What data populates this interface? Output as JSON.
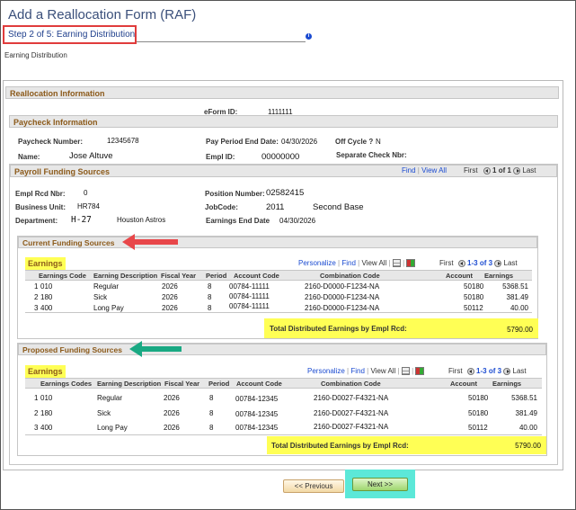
{
  "header": {
    "title": "Add a Reallocation Form (RAF)",
    "step": "Step 2 of 5: Earning Distribution",
    "info_icon": "i",
    "subtitle": "Earning Distribution"
  },
  "realloc": {
    "heading": "Reallocation Information",
    "eform_label": "eForm ID:",
    "eform_value": "1111111"
  },
  "paycheck": {
    "heading": "Paycheck Information",
    "check_number_label": "Paycheck Number:",
    "check_number_value": "12345678",
    "period_end_label": "Pay Period End Date:",
    "period_end_value": "04/30/2026",
    "off_cycle_label": "Off Cycle ?",
    "off_cycle_value": "N",
    "name_label": "Name:",
    "name_value": "Jose Altuve",
    "emplid_label": "Empl ID:",
    "emplid_value": "00000000",
    "separate_check_label": "Separate Check Nbr:"
  },
  "payroll": {
    "heading": "Payroll Funding Sources",
    "find": "Find",
    "view_all": "View All",
    "first": "First",
    "count": "1 of 1",
    "last": "Last",
    "rcd_label": "Empl Rcd Nbr:",
    "rcd_value": "0",
    "position_label": "Position Number:",
    "position_value": "02582415",
    "bu_label": "Business Unit:",
    "bu_value": "HR784",
    "jobcode_label": "JobCode:",
    "jobcode_value": "2011",
    "jobcode_desc": "Second Base",
    "dept_label": "Department:",
    "dept_value": "H-27",
    "dept_desc": "Houston Astros",
    "earn_end_label": "Earnings End Date",
    "earn_end_value": "04/30/2026"
  },
  "current": {
    "heading": "Current Funding Sources",
    "grid_title": "Earnings",
    "personalize": "Personalize",
    "find": "Find",
    "view_all": "View All",
    "first": "First",
    "count": "1-3 of 3",
    "last": "Last",
    "columns": [
      "Earnings Code",
      "Earning Description",
      "Fiscal Year",
      "Period",
      "Account Code",
      "Combination Code",
      "Account",
      "Earnings"
    ],
    "rows": [
      {
        "num": "1",
        "code": "010",
        "desc": "Regular",
        "fy": "2026",
        "period": "8",
        "acct_code": "00784-11111",
        "combo": "2160-D0000-F1234-NA",
        "account": "50180",
        "earnings": "5368.51"
      },
      {
        "num": "2",
        "code": "180",
        "desc": "Sick",
        "fy": "2026",
        "period": "8",
        "acct_code": "00784-11111",
        "combo": "2160-D0000-F1234-NA",
        "account": "50180",
        "earnings": "381.49"
      },
      {
        "num": "3",
        "code": "400",
        "desc": "Long Pay",
        "fy": "2026",
        "period": "8",
        "acct_code": "00784-11111",
        "combo": "2160-D0000-F1234-NA",
        "account": "50112",
        "earnings": "40.00"
      }
    ],
    "total_label": "Total Distributed Earnings by Empl Rcd:",
    "total_value": "5790.00"
  },
  "proposed": {
    "heading": "Proposed Funding Sources",
    "grid_title": "Earnings",
    "personalize": "Personalize",
    "find": "Find",
    "view_all": "View All",
    "first": "First",
    "count": "1-3 of 3",
    "last": "Last",
    "columns": [
      "Earnings Codes",
      "Earning Description",
      "Fiscal Year",
      "Period",
      "Account Code",
      "Combination Code",
      "Account",
      "Earnings"
    ],
    "rows": [
      {
        "num": "1",
        "code": "010",
        "desc": "Regular",
        "fy": "2026",
        "period": "8",
        "acct_code": "00784-12345",
        "combo": "2160-D0027-F4321-NA",
        "account": "50180",
        "earnings": "5368.51"
      },
      {
        "num": "2",
        "code": "180",
        "desc": "Sick",
        "fy": "2026",
        "period": "8",
        "acct_code": "00784-12345",
        "combo": "2160-D0027-F4321-NA",
        "account": "50180",
        "earnings": "381.49"
      },
      {
        "num": "3",
        "code": "400",
        "desc": "Long Pay",
        "fy": "2026",
        "period": "8",
        "acct_code": "00784-12345",
        "combo": "2160-D0027-F4321-NA",
        "account": "50112",
        "earnings": "40.00"
      }
    ],
    "total_label": "Total Distributed Earnings by Empl Rcd:",
    "total_value": "5790.00"
  },
  "buttons": {
    "previous": "<< Previous",
    "next": "Next >>"
  },
  "colors": {
    "highlight_yellow": "#ffff55",
    "red_arrow": "#e8474a",
    "green_arrow": "#1aa983",
    "next_highlight": "#5ce8d8",
    "section_text": "#8c5a1a"
  }
}
